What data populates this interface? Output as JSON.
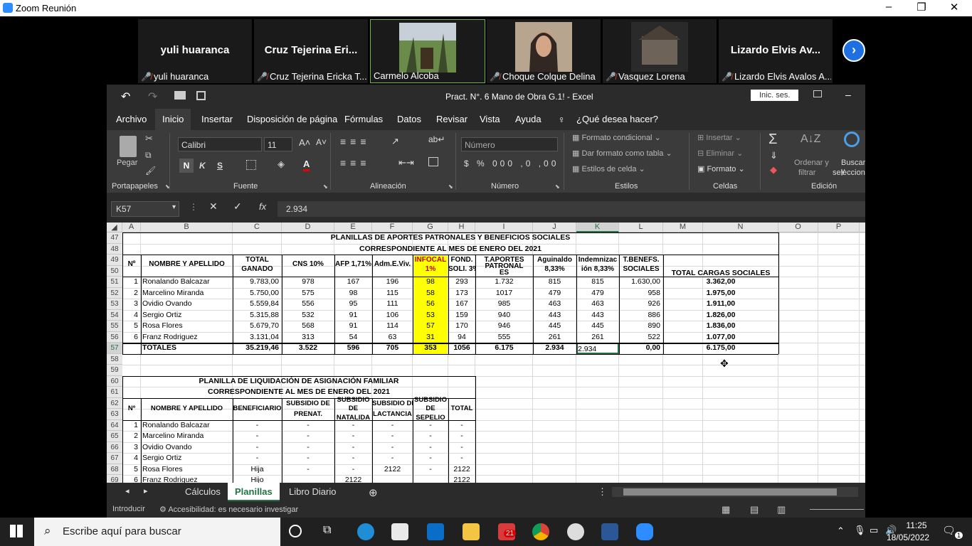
{
  "zoom": {
    "title": "Zoom Reunión",
    "min": "–",
    "max": "❐",
    "close": "✕"
  },
  "participants": [
    {
      "big": "yuli huaranca",
      "name": "yuli huaranca"
    },
    {
      "big": "Cruz Tejerina Eri...",
      "name": "Cruz Tejerina Ericka T..."
    },
    {
      "big": "",
      "name": "Carmelo Alcoba"
    },
    {
      "big": "",
      "name": "Choque Colque Delina"
    },
    {
      "big": "",
      "name": "Vasquez Lorena"
    },
    {
      "big": "Lizardo Elvis Av...",
      "name": "Lizardo Elvis Avalos A..."
    }
  ],
  "next_icon": "›",
  "excel": {
    "title": "Pract. N°. 6  Mano de Obra  G.1!  -  Excel",
    "signin": "Inic. ses.",
    "menu": [
      "Archivo",
      "Inicio",
      "Insertar",
      "Disposición de página",
      "Fórmulas",
      "Datos",
      "Revisar",
      "Vista",
      "Ayuda",
      "¿Qué desea hacer?"
    ],
    "ribbon": {
      "paste": "Pegar",
      "font": "Calibri",
      "size": "11",
      "bold": "N",
      "italic": "K",
      "underline": "S",
      "numfmt": "Número",
      "cond": "Formato condicional",
      "table": "Dar formato como tabla",
      "styles": "Estilos de celda",
      "insert": "Insertar",
      "delete": "Eliminar",
      "format": "Formato",
      "sort": "Ordenar y",
      "filter": "filtrar",
      "find": "Buscar y",
      "select": "seleccionar",
      "groups": [
        "Portapapeles",
        "Fuente",
        "Alineación",
        "Número",
        "Estilos",
        "Celdas",
        "Edición"
      ]
    },
    "namebox": "K57",
    "formula": "2.934",
    "fx": "fx",
    "cols": [
      "A",
      "B",
      "C",
      "D",
      "E",
      "F",
      "G",
      "H",
      "I",
      "J",
      "K",
      "L",
      "M",
      "N",
      "O",
      "P",
      "Q"
    ],
    "rows": [
      "47",
      "48",
      "49",
      "50",
      "51",
      "52",
      "53",
      "54",
      "55",
      "56",
      "57",
      "58",
      "59",
      "60",
      "61",
      "62",
      "63",
      "64",
      "65",
      "66",
      "67",
      "68",
      "69"
    ],
    "t1": {
      "title": "PLANILLAS DE APORTES PATRONALES Y BENEFICIOS SOCIALES",
      "subtitle": "CORRESPONDIENTE AL MES DE ENERO DEL 2021",
      "h": [
        "Nº",
        "NOMBRE Y APELLIDO",
        "TOTAL",
        "GANADO",
        "CNS 10%",
        "AFP 1,71%",
        "Adm.E.Viv.",
        "INFOCAL",
        "1%",
        "FOND.",
        "SOLI. 3%",
        "T.APORTES",
        "PATRONAL",
        "ES",
        "Aguinaldo",
        "8,33%",
        "Indemnizac",
        "ión 8,33%",
        "T.BENEFS.",
        "SOCIALES",
        "TOTAL CARGAS SOCIALES"
      ],
      "rows": [
        [
          "1",
          "Ronalando Balcazar",
          "9.783,00",
          "978",
          "167",
          "196",
          "98",
          "293",
          "1.732",
          "815",
          "815",
          "1.630,00",
          "3.362,00"
        ],
        [
          "2",
          "Marcelino Miranda",
          "5.750,00",
          "575",
          "98",
          "115",
          "58",
          "173",
          "1017",
          "479",
          "479",
          "958",
          "1.975,00"
        ],
        [
          "3",
          "Ovidio Ovando",
          "5.559,84",
          "556",
          "95",
          "111",
          "56",
          "167",
          "985",
          "463",
          "463",
          "926",
          "1.911,00"
        ],
        [
          "4",
          "Sergio Ortiz",
          "5.315,88",
          "532",
          "91",
          "106",
          "53",
          "159",
          "940",
          "443",
          "443",
          "886",
          "1.826,00"
        ],
        [
          "5",
          "Rosa Flores",
          "5.679,70",
          "568",
          "91",
          "114",
          "57",
          "170",
          "946",
          "445",
          "445",
          "890",
          "1.836,00"
        ],
        [
          "6",
          "Franz Rodriguez",
          "3.131,04",
          "313",
          "54",
          "63",
          "31",
          "94",
          "555",
          "261",
          "261",
          "522",
          "1.077,00"
        ]
      ],
      "totals": [
        "TOTALES",
        "35.219,46",
        "3.522",
        "596",
        "705",
        "353",
        "1056",
        "6.175",
        "2.934",
        "2.934",
        "0,00",
        "6.175,00"
      ]
    },
    "t2": {
      "title": "PLANILLA DE LIQUIDACIÓN DE ASIGNACIÓN FAMILIAR",
      "subtitle": "CORRESPONDIENTE AL MES DE ENERO DEL 2021",
      "h": [
        "Nº",
        "NOMBRE Y APELLIDO",
        "BENEFICIARIO",
        "SUBSIDIO DE",
        "PRENAT.",
        "SUBSIDIO",
        "DE",
        "NATALIDA",
        "SUBSIDIO DE",
        "LACTANCIA",
        "SUBSIDIO",
        "DE",
        "SEPELIO",
        "TOTAL"
      ],
      "rows": [
        [
          "1",
          "Ronalando Balcazar",
          "-",
          "-",
          "-",
          "-",
          "-",
          "-"
        ],
        [
          "2",
          "Marcelino Miranda",
          "-",
          "-",
          "-",
          "-",
          "-",
          "-"
        ],
        [
          "3",
          "Ovidio Ovando",
          "-",
          "-",
          "-",
          "-",
          "-",
          "-"
        ],
        [
          "4",
          "Sergio Ortiz",
          "-",
          "-",
          "-",
          "-",
          "-",
          "-"
        ],
        [
          "5",
          "Rosa Flores",
          "Hija",
          "-",
          "-",
          "2122",
          "-",
          "2122"
        ],
        [
          "6",
          "Franz Rodriguez",
          "Hijo",
          "",
          "2122",
          "",
          "",
          "2122"
        ]
      ]
    },
    "tabs": [
      "Cálculos",
      "Planillas",
      "Libro Diario"
    ],
    "status": {
      "mode": "Introducir",
      "access": "Accesibilidad: es necesario investigar"
    }
  },
  "taskbar": {
    "search": "Escribe aquí para buscar",
    "time": "11:25",
    "date": "18/05/2022",
    "badge": "21",
    "notif": "1"
  }
}
